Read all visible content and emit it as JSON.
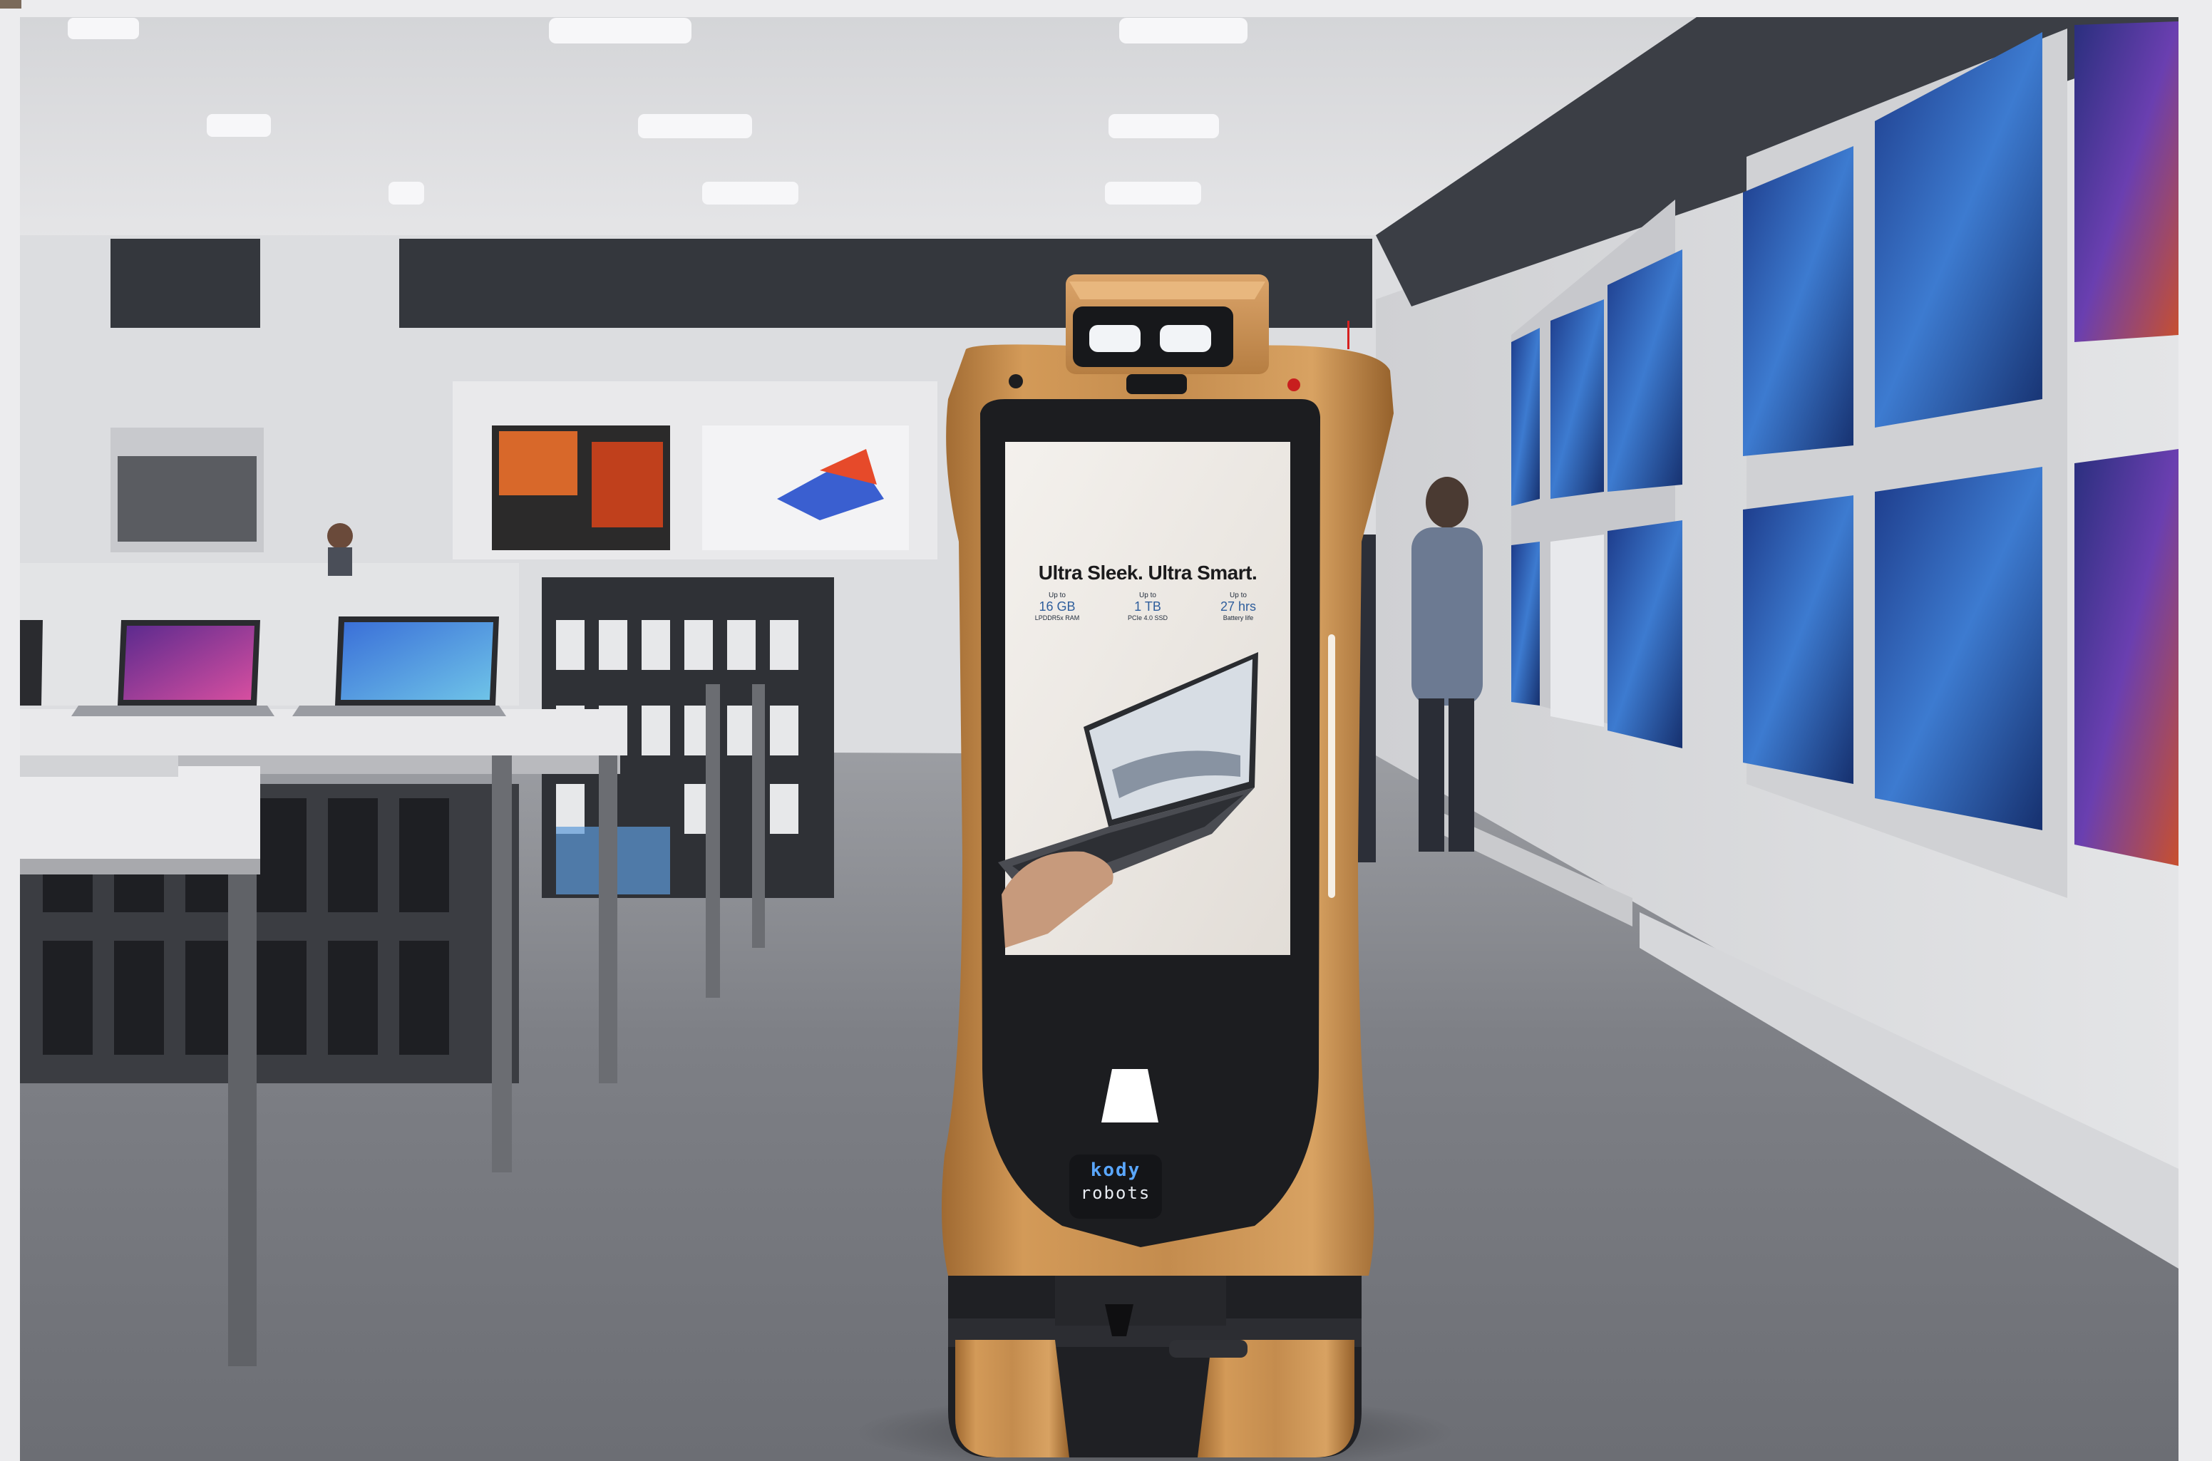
{
  "screen": {
    "headline": "Ultra Sleek. Ultra Smart.",
    "specs": [
      {
        "prefix": "Up to",
        "value": "16 GB",
        "caption": "LPDDR5x RAM"
      },
      {
        "prefix": "Up to",
        "value": "1 TB",
        "caption": "PCIe 4.0 SSD"
      },
      {
        "prefix": "Up to",
        "value": "27 hrs",
        "caption": "Battery life"
      }
    ]
  },
  "robot": {
    "logo_line1": "kody",
    "logo_line2": "robots"
  },
  "colors": {
    "robot_body": "#c28c4c",
    "robot_dark": "#1d1d1f",
    "screen_bg": "#eeeae6",
    "logo_blue": "#5aa7ff",
    "floor": "#7d7f85",
    "wall": "#d8d9dc"
  }
}
